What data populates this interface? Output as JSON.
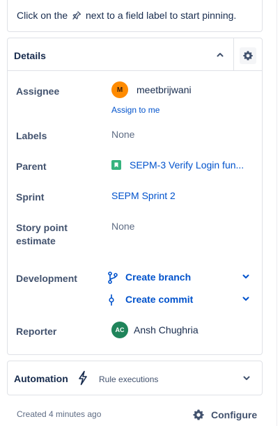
{
  "pin_hint": {
    "before": "Click on the",
    "after": "next to a field label to start pinning."
  },
  "details": {
    "title": "Details",
    "fields": {
      "assignee": {
        "label": "Assignee",
        "avatar_initial": "M",
        "value": "meetbrijwani",
        "assign_to_me": "Assign to me"
      },
      "labels": {
        "label": "Labels",
        "value": "None"
      },
      "parent": {
        "label": "Parent",
        "value": "SEPM-3 Verify Login fun..."
      },
      "sprint": {
        "label": "Sprint",
        "value": "SEPM Sprint 2"
      },
      "story_points": {
        "label_line1": "Story point",
        "label_line2": "estimate",
        "value": "None"
      },
      "development": {
        "label": "Development",
        "create_branch": "Create branch",
        "create_commit": "Create commit"
      },
      "reporter": {
        "label": "Reporter",
        "avatar_initials": "AC",
        "value": "Ansh Chughria"
      }
    }
  },
  "automation": {
    "title": "Automation",
    "subtitle": "Rule executions"
  },
  "footer": {
    "created": "Created 4 minutes ago",
    "configure": "Configure"
  },
  "icons": [
    "pin-icon",
    "chevron-up-icon",
    "gear-icon",
    "story-icon",
    "branch-icon",
    "commit-icon",
    "chevron-down-icon",
    "lightning-icon"
  ],
  "colors": {
    "link": "#0052cc",
    "story_green": "#36b37e",
    "assignee_avatar": "#ff8b00",
    "reporter_avatar": "#1f845a"
  }
}
